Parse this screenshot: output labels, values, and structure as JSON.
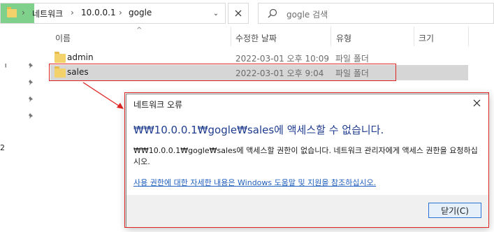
{
  "address": {
    "segments": [
      "네트워크",
      "10.0.0.1",
      "gogle"
    ],
    "separator": "›",
    "dropdown": "⌄"
  },
  "search": {
    "placeholder": "gogle 검색"
  },
  "columns": {
    "name": "이름",
    "modified": "수정한 날짜",
    "type": "유형",
    "size": "크기"
  },
  "rows": [
    {
      "name": "admin",
      "modified": "2022-03-01 오후 10:09",
      "type": "파일 폴더",
      "selected": false
    },
    {
      "name": "sales",
      "modified": "2022-03-01 오후 9:04",
      "type": "파일 폴더",
      "selected": true
    }
  ],
  "nav_chars": [
    "ᅵ",
    "2"
  ],
  "dialog": {
    "title": "네트워크 오류",
    "heading": "₩₩10.0.0.1₩gogle₩sales에 액세스할 수 없습니다.",
    "body": "₩₩10.0.0.1₩gogle₩sales에 액세스할 권한이 없습니다. 네트워크 관리자에게 액세스 권한을 요청하십시오.",
    "link": "사용 권한에 대한 자세한 내용은 Windows 도움말 및 지원을 참조하십시오.",
    "close_button": "닫기(C)"
  },
  "colors": {
    "annotation_red": "#e02424",
    "heading_blue": "#1f3c8f",
    "link_blue": "#1f5fbf",
    "folder_yellow": "#f4d26b"
  }
}
